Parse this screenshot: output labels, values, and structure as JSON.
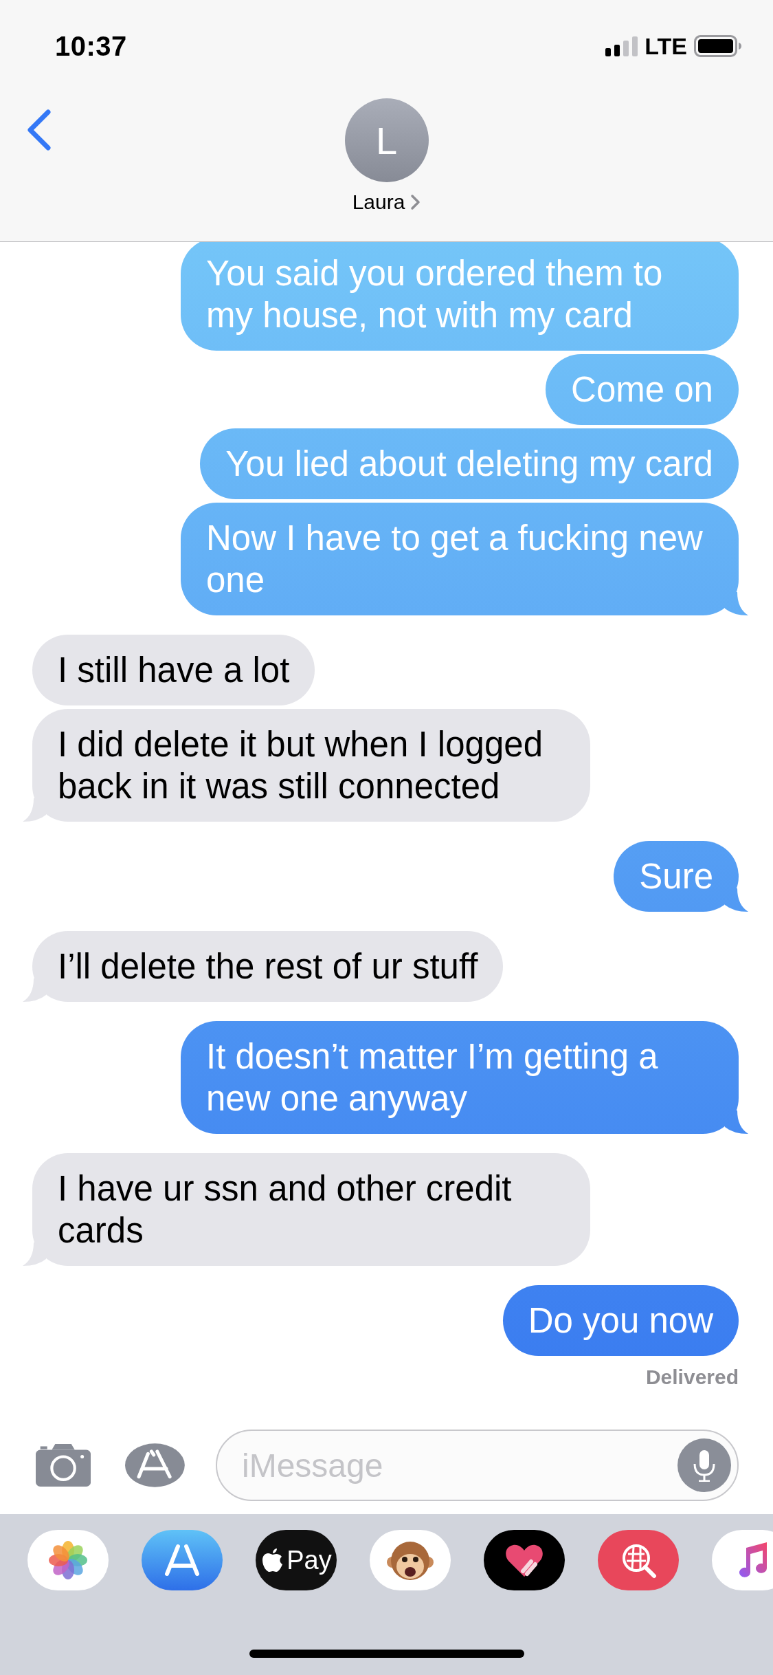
{
  "status_bar": {
    "time": "10:37",
    "network": "LTE"
  },
  "header": {
    "avatar_initial": "L",
    "name": "Laura"
  },
  "messages": [
    {
      "kind": "sent",
      "text": "You said you ordered them to my house, not with my card",
      "tail": false
    },
    {
      "kind": "sent",
      "text": "Come on",
      "tail": false
    },
    {
      "kind": "sent",
      "text": "You lied about deleting my card",
      "tail": false
    },
    {
      "kind": "sent",
      "text": "Now I have to get a fucking new one",
      "tail": true
    },
    {
      "kind": "received",
      "text": "I still have a lot",
      "tail": false
    },
    {
      "kind": "received",
      "text": "I did delete it but when I logged back in it was still connected",
      "tail": true
    },
    {
      "kind": "sent",
      "text": "Sure",
      "tail": true
    },
    {
      "kind": "received",
      "text": "I’ll delete the rest of ur stuff",
      "tail": true
    },
    {
      "kind": "sent",
      "text": "It doesn’t matter I’m getting a new one anyway",
      "tail": true
    },
    {
      "kind": "received",
      "text": "I have ur ssn and other credit cards",
      "tail": true
    },
    {
      "kind": "sent",
      "text": "Do you now",
      "tail": false
    }
  ],
  "delivery_status": "Delivered",
  "compose": {
    "placeholder": "iMessage"
  },
  "app_drawer": [
    {
      "kind": "photos"
    },
    {
      "kind": "app_store"
    },
    {
      "kind": "apple_pay",
      "label": "Pay"
    },
    {
      "kind": "animoji"
    },
    {
      "kind": "digital_touch"
    },
    {
      "kind": "image_search"
    },
    {
      "kind": "music"
    }
  ]
}
